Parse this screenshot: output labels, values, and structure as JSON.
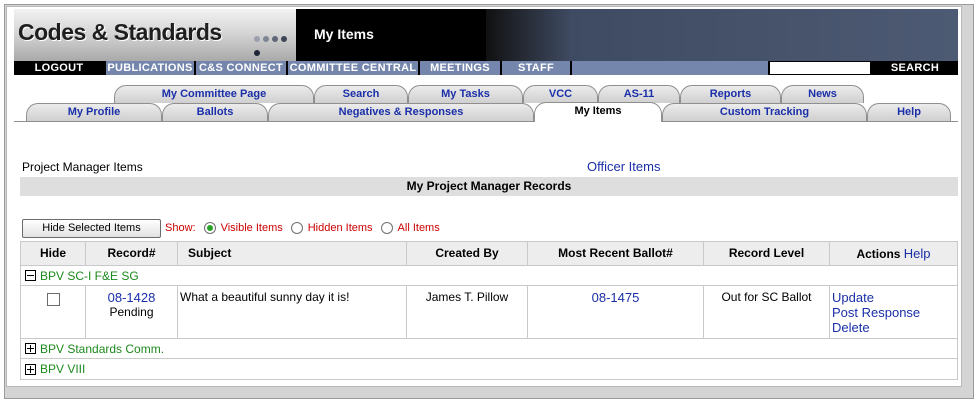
{
  "header": {
    "brand": "Codes & Standards",
    "page_title": "My Items",
    "colors": {
      "banner_dark": "#2f3c55",
      "nav_blue": "#7586ad",
      "link": "#1a2fa8"
    }
  },
  "nav": {
    "items": [
      "LOGOUT",
      "PUBLICATIONS",
      "C&S CONNECT",
      "COMMITTEE CENTRAL",
      "MEETINGS",
      "STAFF"
    ],
    "search_label": "SEARCH"
  },
  "tabs": {
    "top_row": [
      "My Committee Page",
      "Search",
      "My Tasks",
      "VCC",
      "AS-11",
      "Reports",
      "News"
    ],
    "bottom_row": [
      "My Profile",
      "Ballots",
      "Negatives & Responses",
      "My Items",
      "Custom Tracking",
      "Help"
    ],
    "active": "My Items"
  },
  "content": {
    "pm_label": "Project Manager Items",
    "officer_link": "Officer Items",
    "section_title": "My Project Manager Records",
    "hide_button": "Hide Selected Items",
    "show_label": "Show:",
    "show_options": [
      "Visible Items",
      "Hidden Items",
      "All Items"
    ],
    "selected_show": "Visible Items"
  },
  "table": {
    "headers": {
      "hide": "Hide",
      "record": "Record#",
      "subject": "Subject",
      "created_by": "Created By",
      "ballot": "Most Recent Ballot#",
      "level": "Record Level",
      "actions": "Actions",
      "help": "Help"
    },
    "groups": [
      {
        "name": "BPV SC-I F&E SG",
        "expanded": true
      },
      {
        "name": "BPV Standards Comm.",
        "expanded": false
      },
      {
        "name": "BPV VIII",
        "expanded": false
      }
    ],
    "row": {
      "record": "08-1428",
      "status": "Pending",
      "subject": "What a beautiful sunny day it is!",
      "created_by": "James T. Pillow",
      "ballot": "08-1475",
      "level": "Out for SC Ballot",
      "actions": [
        "Update",
        "Post Response",
        "Delete"
      ]
    }
  }
}
